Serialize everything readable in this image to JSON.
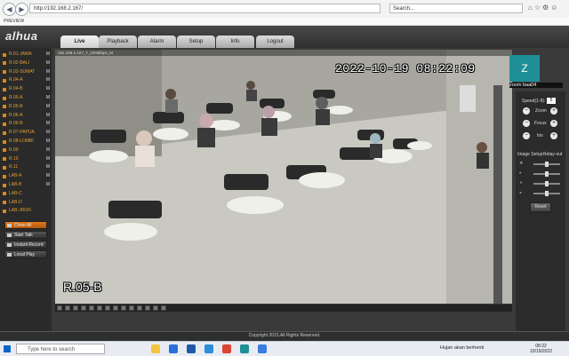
{
  "browser": {
    "url": "http://192.168.2.167/",
    "search_placeholder": "Search...",
    "tab_label": "PREVIEW",
    "icons": [
      "home-icon",
      "star-icon",
      "gear-icon",
      "smiley-icon"
    ]
  },
  "app": {
    "logo": "alhua",
    "tabs": [
      "Live",
      "Playback",
      "Alarm",
      "Setup",
      "Info",
      "Logout"
    ],
    "active_tab": "Live"
  },
  "channels": [
    {
      "name": "R.01-JAWA",
      "flag": "M"
    },
    {
      "name": "R.02-BALI",
      "flag": "M"
    },
    {
      "name": "R.03-SUMAT",
      "flag": "M"
    },
    {
      "name": "R.04-A",
      "flag": "M"
    },
    {
      "name": "R.04-B",
      "flag": "M"
    },
    {
      "name": "R.05-A",
      "flag": "M"
    },
    {
      "name": "R.05-B",
      "flag": "M"
    },
    {
      "name": "R.06-A",
      "flag": "M"
    },
    {
      "name": "R.06-B",
      "flag": "M"
    },
    {
      "name": "R.07-PAPUA",
      "flag": "M"
    },
    {
      "name": "R.08-LOMBI",
      "flag": "M"
    },
    {
      "name": "R.09",
      "flag": "M"
    },
    {
      "name": "R.10",
      "flag": "M"
    },
    {
      "name": "R.11",
      "flag": "M"
    },
    {
      "name": "LAB-A",
      "flag": "M"
    },
    {
      "name": "LAB-B",
      "flag": "M"
    },
    {
      "name": "LAB-C",
      "flag": ""
    },
    {
      "name": "LAB-D",
      "flag": ""
    },
    {
      "name": "LAB-JRGN",
      "flag": ""
    }
  ],
  "left_buttons": {
    "close_all": "Close All",
    "start_talk": "Start Talk",
    "instant_record": "Instant Record",
    "local_play": "Local Play"
  },
  "video": {
    "osd_info": "192.168.2.167_7_1004kbps_M",
    "timestamp": "2022-10-19 08:22:09",
    "room_label": "R.05-B"
  },
  "zoom_overlay": {
    "initial": "Z",
    "name": "zoom baa04"
  },
  "ptz": {
    "speed_label": "Speed(1-8):",
    "speed_value": "5",
    "zoom_label": "Zoom",
    "focus_label": "Focus",
    "iris_label": "Iris",
    "image_setup_label": "Image Setup",
    "relay_out_label": "Relay-out",
    "reset_label": "Reset",
    "slider_levels": [
      0.5,
      0.5,
      0.5,
      0.5
    ]
  },
  "footer": {
    "copyright": "Copyright 2015.All Rights Reserved."
  },
  "taskbar": {
    "search_placeholder": "Type here to search",
    "weather": "Hujan akan berhenti",
    "time": "08:22",
    "date": "10/19/2022"
  }
}
